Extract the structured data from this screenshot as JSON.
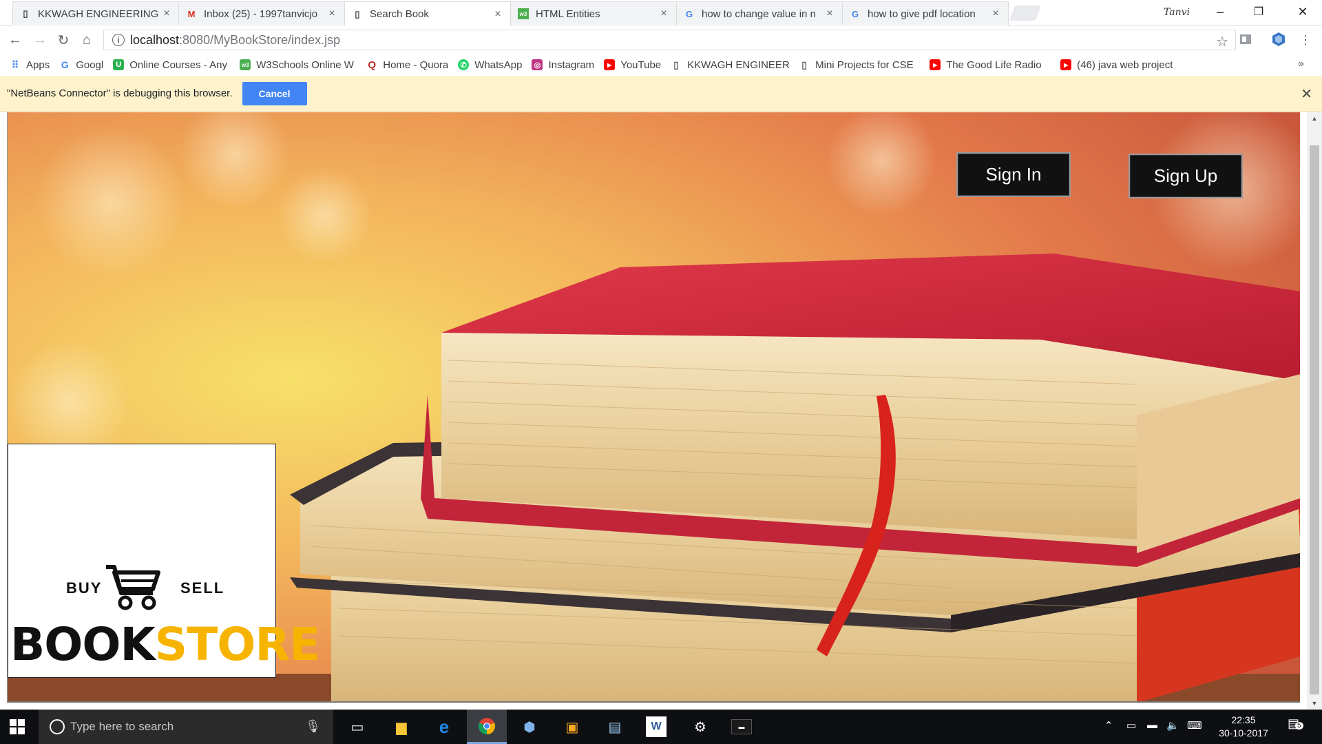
{
  "browser": {
    "tabs": [
      {
        "title": "KKWAGH ENGINEERING",
        "favicon": "page-icon"
      },
      {
        "title": "Inbox (25) - 1997tanvicjo",
        "favicon": "gmail-icon"
      },
      {
        "title": "Search Book",
        "favicon": "page-icon",
        "active": true
      },
      {
        "title": "HTML Entities",
        "favicon": "w3schools-icon"
      },
      {
        "title": "how to change value in n",
        "favicon": "google-icon"
      },
      {
        "title": "how to give pdf location",
        "favicon": "google-icon"
      }
    ],
    "profile_name": "Tanvi",
    "url_host": "localhost",
    "url_path": ":8080/MyBookStore/index.jsp",
    "bookmarks": [
      {
        "label": "Apps",
        "icon": "apps-grid-icon",
        "color": "#4285f4"
      },
      {
        "label": "Googl",
        "icon": "google-icon",
        "color": "#4285f4"
      },
      {
        "label": "Online Courses - Any",
        "icon": "udemy-icon",
        "color": "#2ab24f"
      },
      {
        "label": "W3Schools Online W",
        "icon": "w3schools-icon",
        "color": "#4caf50"
      },
      {
        "label": "Home - Quora",
        "icon": "quora-icon",
        "color": "#b92b27"
      },
      {
        "label": "WhatsApp",
        "icon": "whatsapp-icon",
        "color": "#25d366"
      },
      {
        "label": "Instagram",
        "icon": "instagram-icon",
        "color": "#c13584"
      },
      {
        "label": "YouTube",
        "icon": "youtube-icon",
        "color": "#ff0000"
      },
      {
        "label": "KKWAGH ENGINEERI",
        "icon": "page-icon",
        "color": "#ffffff"
      },
      {
        "label": "Mini Projects for CSE",
        "icon": "page-icon",
        "color": "#ffffff"
      },
      {
        "label": "The Good Life Radio",
        "icon": "youtube-icon",
        "color": "#ff0000"
      },
      {
        "label": "(46) java web project",
        "icon": "youtube-icon",
        "color": "#ff0000"
      }
    ],
    "bookmarks_more": "»",
    "infobar_message": "\"NetBeans Connector\" is debugging this browser.",
    "infobar_cancel": "Cancel"
  },
  "page": {
    "sign_in": "Sign In",
    "sign_up": "Sign Up",
    "logo": {
      "buy": "BUY",
      "sell": "SELL",
      "word_dark": "BOOK",
      "word_accent": "STORE",
      "accent_color": "#f6b400"
    }
  },
  "taskbar": {
    "search_placeholder": "Type here to search",
    "time": "22:35",
    "date": "30-10-2017",
    "notification_count": "5"
  }
}
